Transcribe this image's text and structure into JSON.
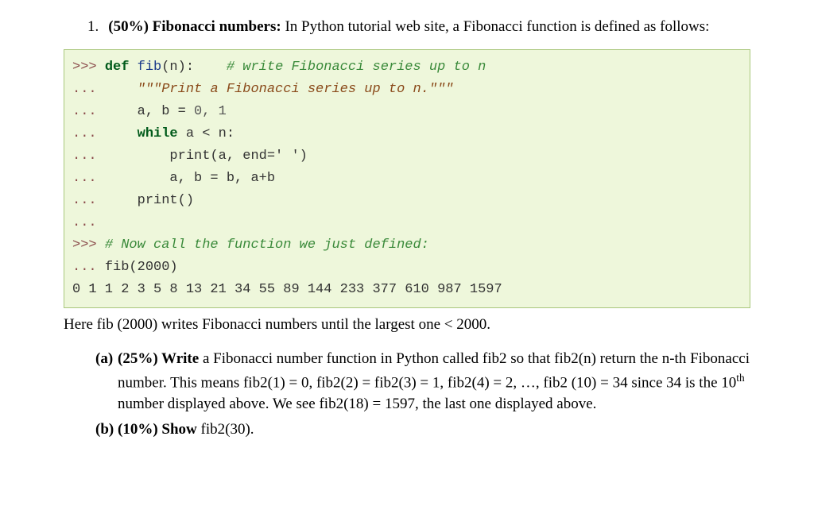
{
  "question": {
    "number": "1.",
    "weight": "(50%)",
    "title": "Fibonacci numbers:",
    "intro_rest": " In Python tutorial web site, a Fibonacci function is defined as follows:"
  },
  "code": {
    "l1_prompt": ">>> ",
    "l1_kw": "def",
    "l1_func": " fib",
    "l1_rest": "(n):    ",
    "l1_comment": "# write Fibonacci series up to n",
    "l2_prompt": "...     ",
    "l2_string": "\"\"\"Print a Fibonacci series up to n.\"\"\"",
    "l3_prompt": "...     ",
    "l3_text": "a, b ",
    "l3_eq": "=",
    "l3_vals": " 0, 1",
    "l4_prompt": "...     ",
    "l4_kw": "while",
    "l4_rest": " a < n:",
    "l5_prompt": "...         ",
    "l5_func": "print",
    "l5_rest": "(a, end=' ')",
    "l6_prompt": "...         ",
    "l6_text": "a, b = b, a+b",
    "l7_prompt": "...     ",
    "l7_func": "print",
    "l7_rest": "()",
    "l8_prompt": "...",
    "l9_prompt": ">>> ",
    "l9_comment": "# Now call the function we just defined:",
    "l10_prompt": "... ",
    "l10_call": "fib(2000)",
    "l11_output": "0 1 1 2 3 5 8 13 21 34 55 89 144 233 377 610 987 1597"
  },
  "explain": "Here fib (2000) writes Fibonacci numbers until the largest one < 2000.",
  "parts": {
    "a_label": "(a)",
    "a_weight": "(25%) Write",
    "a_text_1": " a Fibonacci number function in Python called fib2 so that fib2(n) return the n-th Fibonacci number. This means fib2(1) = 0, fib2(2) = fib2(3) = 1, fib2(4) = 2, …, fib2 (10) = 34 since 34 is the 10",
    "a_sup": "th",
    "a_text_2": " number displayed above. We see fib2(18) = 1597, the last one displayed above.",
    "b_label": "(b)",
    "b_weight": "(10%) Show",
    "b_text": " fib2(30)."
  }
}
